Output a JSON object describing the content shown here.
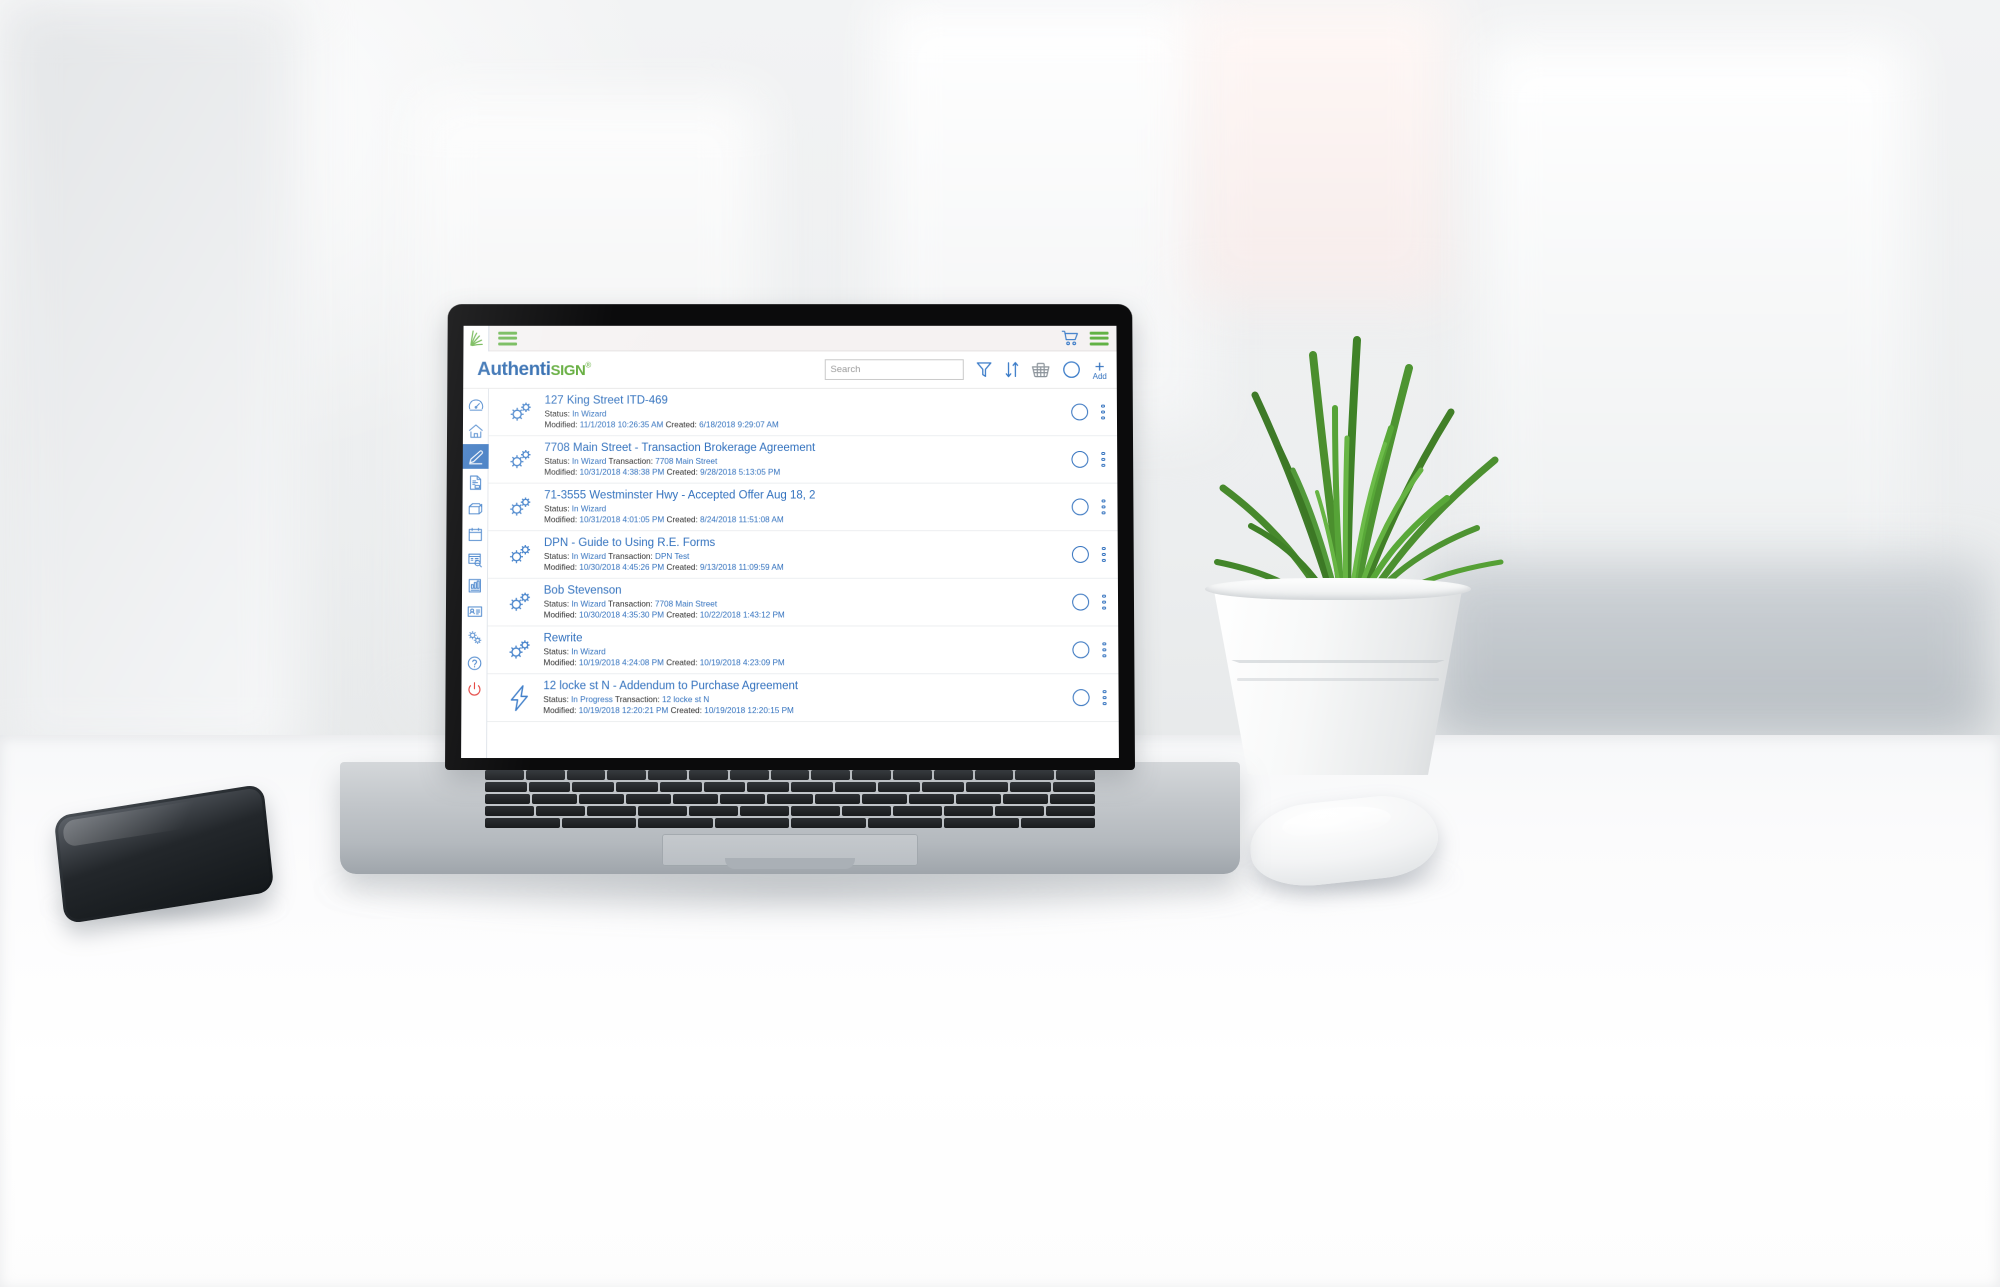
{
  "topbar": {
    "logo_icon": "authentisign-leaf-logo",
    "menu_icon": "hamburger-menu-icon",
    "cart_icon": "shopping-cart-icon",
    "right_menu_icon": "hamburger-menu-icon",
    "accent_green": "#62b245",
    "accent_blue": "#2f6fbd"
  },
  "header": {
    "brand_primary": "Authenti",
    "brand_secondary": "SIGN",
    "brand_mark": "®",
    "search": {
      "value": "",
      "placeholder": "Search"
    },
    "tools": [
      {
        "name": "filter-icon",
        "label": "Filter"
      },
      {
        "name": "sort-icon",
        "label": "Sort"
      },
      {
        "name": "basket-icon",
        "label": "Basket"
      },
      {
        "name": "select-circle-icon",
        "label": "Select"
      }
    ],
    "add_button": {
      "symbol": "+",
      "label": "Add"
    }
  },
  "sidebar": {
    "items": [
      {
        "name": "sidebar-item-dashboard",
        "icon": "gauge-icon",
        "active": false
      },
      {
        "name": "sidebar-item-home",
        "icon": "home-icon",
        "active": false
      },
      {
        "name": "sidebar-item-sign",
        "icon": "pen-icon",
        "active": true
      },
      {
        "name": "sidebar-item-documents",
        "icon": "document-icon",
        "active": false
      },
      {
        "name": "sidebar-item-box",
        "icon": "open-box-icon",
        "active": false
      },
      {
        "name": "sidebar-item-calendar",
        "icon": "calendar-icon",
        "active": false
      },
      {
        "name": "sidebar-item-search-records",
        "icon": "document-search-icon",
        "active": false
      },
      {
        "name": "sidebar-item-reports",
        "icon": "chart-report-icon",
        "active": false
      },
      {
        "name": "sidebar-item-contacts",
        "icon": "contact-card-icon",
        "active": false
      },
      {
        "name": "sidebar-item-settings",
        "icon": "gears-icon",
        "active": false
      },
      {
        "name": "sidebar-item-help",
        "icon": "question-mark-icon",
        "active": false
      },
      {
        "name": "sidebar-item-logout",
        "icon": "power-icon",
        "active": false
      }
    ]
  },
  "list": {
    "labels": {
      "status": "Status:",
      "transaction": "Transaction:",
      "modified": "Modified:",
      "created": "Created:"
    },
    "rows": [
      {
        "title": "127 King Street ITD-469",
        "icon": "gears-icon",
        "status": "In Wizard",
        "transaction": "",
        "modified": "11/1/2018 10:26:35 AM",
        "created": "6/18/2018 9:29:07 AM"
      },
      {
        "title": "7708 Main Street - Transaction Brokerage Agreement",
        "icon": "gears-icon",
        "status": "In Wizard",
        "transaction": "7708 Main Street",
        "modified": "10/31/2018 4:38:38 PM",
        "created": "9/28/2018 5:13:05 PM"
      },
      {
        "title": "71-3555 Westminster Hwy - Accepted Offer Aug 18, 2",
        "icon": "gears-icon",
        "status": "In Wizard",
        "transaction": "",
        "modified": "10/31/2018 4:01:05 PM",
        "created": "8/24/2018 11:51:08 AM"
      },
      {
        "title": "DPN - Guide to Using R.E. Forms",
        "icon": "gears-icon",
        "status": "In Wizard",
        "transaction": "DPN Test",
        "modified": "10/30/2018 4:45:26 PM",
        "created": "9/13/2018 11:09:59 AM"
      },
      {
        "title": "Bob Stevenson",
        "icon": "gears-icon",
        "status": "In Wizard",
        "transaction": "7708 Main Street",
        "modified": "10/30/2018 4:35:30 PM",
        "created": "10/22/2018 1:43:12 PM"
      },
      {
        "title": "Rewrite",
        "icon": "gears-icon",
        "status": "In Wizard",
        "transaction": "",
        "modified": "10/19/2018 4:24:08 PM",
        "created": "10/19/2018 4:23:09 PM"
      },
      {
        "title": "12 locke st N - Addendum to Purchase Agreement",
        "icon": "lightning-bolt-icon",
        "status": "In Progress",
        "transaction": "12 locke st N",
        "modified": "10/19/2018 12:20:21 PM",
        "created": "10/19/2018 12:20:15 PM"
      }
    ],
    "row_actions": {
      "select_icon": "select-circle-icon",
      "menu_icon": "more-vertical-icon"
    }
  }
}
